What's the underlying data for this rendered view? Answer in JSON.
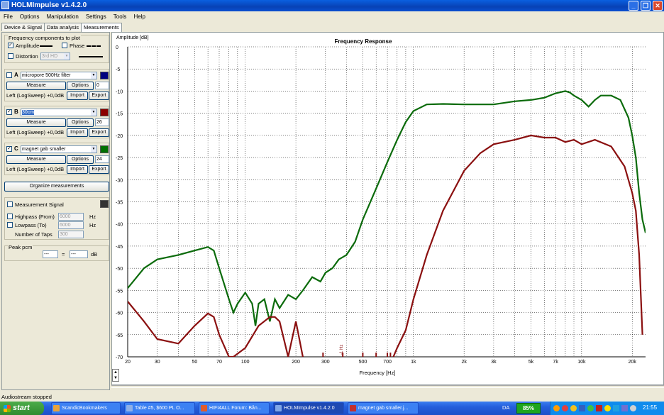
{
  "window": {
    "title": "HOLMImpulse  v1.4.2.0"
  },
  "menu": [
    "File",
    "Options",
    "Manipulation",
    "Settings",
    "Tools",
    "Help"
  ],
  "tabs": [
    "Device & Signal",
    "Data analysis",
    "Measurements"
  ],
  "components": {
    "title": "Frequency components to plot",
    "amplitude": "Amplitude",
    "phase": "Phase",
    "distortion": "Distortion",
    "distortion_value": "3rd HD"
  },
  "measurements": [
    {
      "letter": "A",
      "checked": false,
      "name": "micropore 500Hz filter",
      "color": "#00007f",
      "offset": "0",
      "info": "Left (LogSweep) +0,0dB"
    },
    {
      "letter": "B",
      "checked": true,
      "name": "30cm",
      "color": "#8b0000",
      "offset": "26",
      "info": "Left (LogSweep) +0,0dB"
    },
    {
      "letter": "C",
      "checked": true,
      "name": "magnet gab smaller",
      "color": "#007000",
      "offset": "24",
      "info": "Left (LogSweep) +0,0dB"
    }
  ],
  "buttons": {
    "measure": "Measure",
    "options": "Options",
    "import": "Import",
    "export": "Export",
    "organize": "Organize measurements"
  },
  "signal": {
    "title": "Measurement Signal",
    "highpass": "Highpass (From)",
    "highpass_value": "6000",
    "hz1": "Hz",
    "lowpass": "Lowpass (To)",
    "lowpass_value": "6000",
    "hz2": "Hz",
    "taps": "Number of Taps",
    "taps_value": "300"
  },
  "peak": {
    "title": "Peak pcm",
    "left": "---",
    "eq": "=",
    "right": "---",
    "unit": "dB"
  },
  "chart_data": {
    "type": "line",
    "title": "Frequency Response",
    "ylabel": "Amplitude [dB]",
    "xlabel": "Frequency [Hz]",
    "xscale": "log",
    "xlim": [
      20,
      24000
    ],
    "ylim": [
      -70,
      0
    ],
    "grid": true,
    "x_ticks": [
      "20",
      "30",
      "50",
      "70",
      "100",
      "200",
      "300",
      "500",
      "700",
      "1k",
      "2k",
      "3k",
      "5k",
      "7k",
      "10k",
      "20k"
    ],
    "x_tick_values": [
      20,
      30,
      50,
      70,
      100,
      200,
      300,
      500,
      700,
      1000,
      2000,
      3000,
      5000,
      7000,
      10000,
      20000
    ],
    "y_ticks": [
      "0",
      "-5",
      "-10",
      "-15",
      "-20",
      "-25",
      "-30",
      "-35",
      "-40",
      "-45",
      "-50",
      "-55",
      "-60",
      "-65",
      "-70"
    ],
    "y_tick_values": [
      0,
      -5,
      -10,
      -15,
      -20,
      -25,
      -30,
      -35,
      -40,
      -45,
      -50,
      -55,
      -60,
      -65,
      -70
    ],
    "series": [
      {
        "color": "#0b6b0b",
        "x": [
          20,
          25,
          30,
          40,
          50,
          60,
          65,
          70,
          80,
          85,
          90,
          100,
          110,
          115,
          120,
          130,
          140,
          150,
          160,
          180,
          200,
          220,
          250,
          280,
          300,
          330,
          360,
          400,
          450,
          500,
          600,
          700,
          800,
          900,
          1000,
          1200,
          1500,
          2000,
          2500,
          3000,
          4000,
          5000,
          6000,
          7000,
          8000,
          8500,
          9000,
          10000,
          11000,
          12000,
          13000,
          15000,
          17000,
          19000,
          20000,
          21000,
          22000,
          23000,
          24000
        ],
        "y": [
          -54.5,
          -50,
          -48,
          -47,
          -46,
          -45.2,
          -46,
          -50,
          -57,
          -60,
          -58,
          -55.5,
          -58,
          -63,
          -58,
          -57,
          -62,
          -57,
          -59,
          -56,
          -57,
          -55,
          -52,
          -53,
          -51,
          -50,
          -48,
          -47,
          -44,
          -39,
          -32,
          -26,
          -21,
          -17,
          -14.5,
          -13,
          -12.9,
          -13,
          -13,
          -13,
          -12.3,
          -12,
          -11.5,
          -10.5,
          -10,
          -10.3,
          -11,
          -12,
          -13.5,
          -12,
          -11,
          -11,
          -12,
          -16,
          -20,
          -25,
          -33,
          -39,
          -42
        ]
      },
      {
        "color": "#8b1010",
        "x": [
          20,
          25,
          30,
          40,
          50,
          60,
          65,
          70,
          80,
          85,
          100,
          120,
          140,
          150,
          160,
          180,
          200,
          220
        ],
        "y": [
          -57.5,
          -62,
          -66,
          -67,
          -63,
          -60.2,
          -61,
          -65,
          -70,
          -70,
          -68,
          -63,
          -61,
          -61,
          -62,
          -70,
          -62,
          -70
        ],
        "x2": [
          760,
          800,
          900,
          1000,
          1200,
          1500,
          2000,
          2500,
          3000,
          4000,
          5000,
          6000,
          7000,
          8000,
          9000,
          10000,
          12000,
          15000,
          18000,
          20000,
          21000,
          22000,
          23000
        ],
        "y2": [
          -70,
          -68,
          -64,
          -57,
          -47,
          -37,
          -28,
          -24,
          -22,
          -21,
          -20,
          -20.5,
          -20.5,
          -21.5,
          -21,
          -22,
          -21,
          -22.5,
          -27,
          -33,
          -37,
          -47,
          -65
        ]
      }
    ],
    "spike_label": "-1 Hz"
  },
  "status": "Audiostream stopped",
  "taskbar": {
    "start": "start",
    "items": [
      {
        "label": "ScandicBookmakers",
        "color": "#e8a33c"
      },
      {
        "label": "Table #5, $600 PL O...",
        "color": "#8fb0e8"
      },
      {
        "label": "HIFI4ALL Forum: Bån...",
        "color": "#e05b2b"
      },
      {
        "label": "HOLMImpulse  v1.4.2.0",
        "color": "#7fa6e8"
      },
      {
        "label": "magnet gab smaller.j...",
        "color": "#c03030"
      }
    ],
    "lang": "DA",
    "battery": "85%",
    "clock": "21:55"
  }
}
